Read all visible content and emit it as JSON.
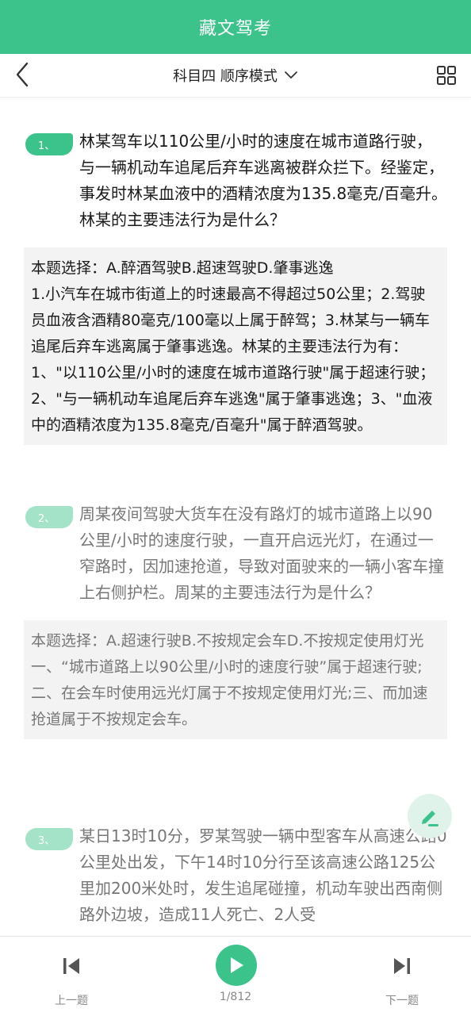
{
  "app": {
    "title": "藏文驾考"
  },
  "nav": {
    "mode_label": "科目四 顺序模式"
  },
  "questions": [
    {
      "badge": "1、",
      "text": "林某驾车以110公里/小时的速度在城市道路行驶，与一辆机动车追尾后弃车逃离被群众拦下。经鉴定，事发时林某血液中的酒精浓度为135.8毫克/百毫升。林某的主要违法行为是什么？",
      "choice": "本题选择：A.醉酒驾驶B.超速驾驶D.肇事逃逸",
      "explanation": "1.小汽车在城市街道上的时速最高不得超过50公里；2.驾驶员血液含酒精80毫克/100毫以上属于醉驾；3.林某与一辆车追尾后弃车逃离属于肇事逃逸。林某的主要违法行为有：1、\"以110公里/小时的速度在城市道路行驶\"属于超速行驶；2、\"与一辆机动车追尾后弃车逃逸\"属于肇事逃逸；3、\"血液中的酒精浓度为135.8毫克/百毫升\"属于醉酒驾驶。"
    },
    {
      "badge": "2、",
      "text": "周某夜间驾驶大货车在没有路灯的城市道路上以90公里/小时的速度行驶，一直开启远光灯，在通过一窄路时，因加速抢道，导致对面驶来的一辆小客车撞上右侧护栏。周某的主要违法行为是什么？",
      "choice": "本题选择：A.超速行驶B.不按规定会车D.不按规定使用灯光",
      "explanation": "一、“城市道路上以90公里/小时的速度行驶”属于超速行驶;二、在会车时使用远光灯属于不按规定使用灯光;三、而加速抢道属于不按规定会车。"
    },
    {
      "badge": "3、",
      "text": "某日13时10分，罗某驾驶一辆中型客车从高速公路0公里处出发，下午14时10分行至该高速公路125公里加200米处时，发生追尾碰撞，机动车驶出西南侧路外边坡，造成11人死亡、2人受"
    }
  ],
  "bottom": {
    "prev_label": "上一题",
    "next_label": "下一题",
    "progress": "1/812"
  },
  "colors": {
    "brand": "#3cc38c",
    "badge_inactive": "#a5e3c8",
    "explain_bg": "#f3f3f3"
  },
  "icons": {
    "back": "chevron-left-icon",
    "mode_dropdown": "chevron-down-icon",
    "grid": "grid-icon",
    "note": "pencil-note-icon",
    "prev": "skip-previous-icon",
    "play": "play-icon",
    "next": "skip-next-icon"
  }
}
